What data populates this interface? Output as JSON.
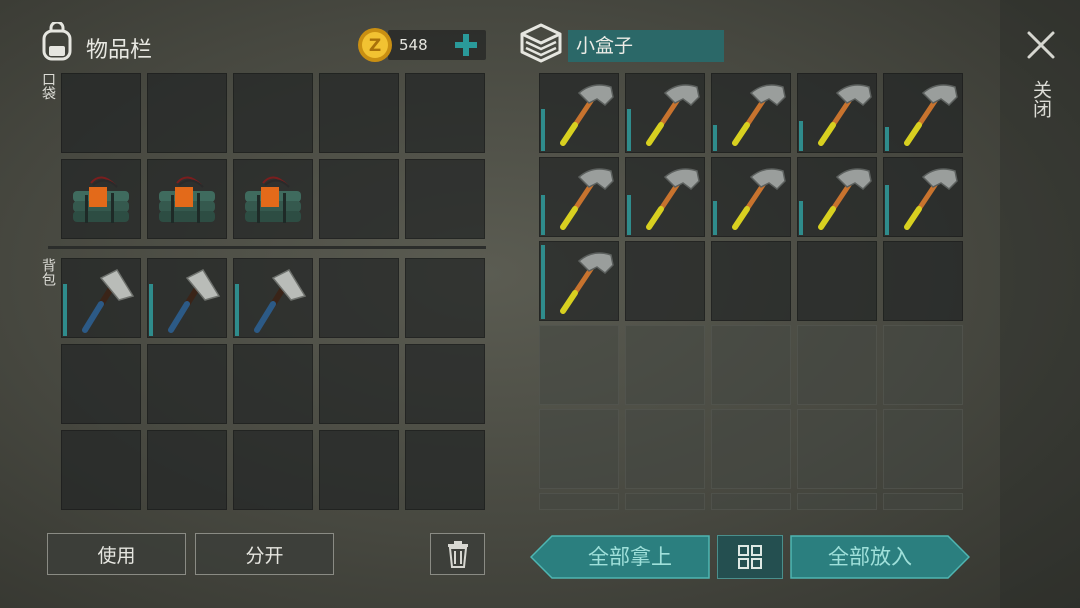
{
  "inventory": {
    "title": "物品栏",
    "coins": "548",
    "pocket_label": "口袋",
    "backpack_label": "背包",
    "pocket_items": [
      "",
      "",
      "",
      "",
      "",
      "c4-explosive-icon",
      "c4-explosive-icon",
      "c4-explosive-icon",
      "",
      ""
    ],
    "backpack_items": [
      "hatchet-icon",
      "hatchet-icon",
      "hatchet-icon",
      "",
      "",
      "",
      "",
      "",
      "",
      "",
      "",
      "",
      "",
      "",
      ""
    ],
    "use_label": "使用",
    "split_label": "分开"
  },
  "container": {
    "title": "小盒子",
    "items": [
      "hammer-icon",
      "hammer-icon",
      "hammer-icon",
      "hammer-icon",
      "hammer-icon",
      "hammer-icon",
      "hammer-icon",
      "hammer-icon",
      "hammer-icon",
      "hammer-icon",
      "hammer-icon"
    ],
    "take_all_label": "全部拿上",
    "put_all_label": "全部放入"
  },
  "close_label": "关闭",
  "colors": {
    "accent": "#2a9a9a",
    "durability": "#2f8c8c",
    "coin": "#d9a520"
  }
}
